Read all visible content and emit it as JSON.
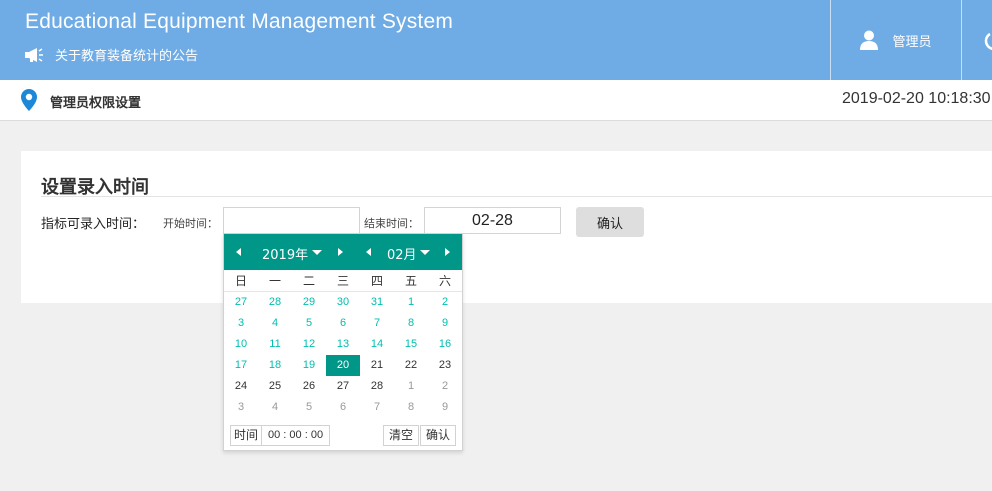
{
  "header": {
    "app_title": "Educational Equipment Management System",
    "notice": "关于教育装备统计的公告",
    "user_name": "管理员",
    "bg_color": "#6fabe4"
  },
  "breadcrumb": {
    "title": "管理员权限设置",
    "datetime": "2019-02-20 10:18:30"
  },
  "card": {
    "title": "设置录入时间",
    "main_label": "指标可录入时间：",
    "start_label": "开始时间：",
    "start_value": "",
    "end_label": "结束时间：",
    "end_value": "02-28",
    "confirm_label": "确认"
  },
  "datepicker": {
    "accent_color": "#009688",
    "year_label": "2019年",
    "month_label": "02月",
    "weekdays": [
      "日",
      "一",
      "二",
      "三",
      "四",
      "五",
      "六"
    ],
    "weeks": [
      [
        "27",
        "28",
        "29",
        "30",
        "31",
        "1",
        "2"
      ],
      [
        "3",
        "4",
        "5",
        "6",
        "7",
        "8",
        "9"
      ],
      [
        "10",
        "11",
        "12",
        "13",
        "14",
        "15",
        "16"
      ],
      [
        "17",
        "18",
        "19",
        "20",
        "21",
        "22",
        "23"
      ],
      [
        "24",
        "25",
        "26",
        "27",
        "28",
        "1",
        "2"
      ],
      [
        "3",
        "4",
        "5",
        "6",
        "7",
        "8",
        "9"
      ]
    ],
    "selected_day": "20",
    "time_label": "时间",
    "time_value": "00 : 00 : 00",
    "clear_label": "清空",
    "ok_label": "确认"
  }
}
